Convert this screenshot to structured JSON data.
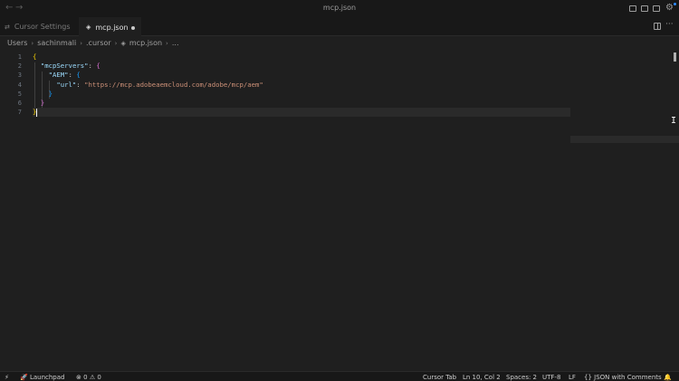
{
  "window": {
    "title": "mcp.json",
    "back_glyph": "←",
    "forward_glyph": "→",
    "settings_glyph": "⚙"
  },
  "tabs": [
    {
      "label": "Cursor Settings",
      "icon": "settings-file-icon",
      "glyph": "⇄",
      "active": false
    },
    {
      "label": "mcp.json",
      "icon": "json-file-icon",
      "glyph": "◈",
      "active": true,
      "modified": true
    }
  ],
  "tabbar_actions": {
    "more_glyph": "···"
  },
  "breadcrumb": [
    {
      "label": "Users"
    },
    {
      "label": "sachinmali"
    },
    {
      "label": ".cursor"
    },
    {
      "label": "mcp.json",
      "glyph": "◈"
    },
    {
      "label": "..."
    }
  ],
  "breadcrumb_sep": "›",
  "editor": {
    "line_numbers": [
      "1",
      "2",
      "3",
      "4",
      "5",
      "6",
      "7"
    ],
    "code": {
      "l1_open": "{",
      "l2_key": "\"mcpServers\"",
      "l2_colon": ": ",
      "l2_open": "{",
      "l3_key": "\"AEM\"",
      "l3_colon": ": ",
      "l3_open": "{",
      "l4_key": "\"url\"",
      "l4_colon": ": ",
      "l4_value": "\"https://mcp.adobeaemcloud.com/adobe/mcp/aem\"",
      "l5_close": "}",
      "l6_close": "}",
      "l7_close": "}"
    },
    "ibeam_glyph": "I"
  },
  "statusbar": {
    "remote_glyph": "⚡",
    "launchpad_glyph": "🚀",
    "launchpad": "Launchpad",
    "errors_glyph": "⊗",
    "errors": "0",
    "warnings_glyph": "⚠",
    "warnings": "0",
    "cursor_tab": "Cursor Tab",
    "position": "Ln 10, Col 2",
    "spaces": "Spaces: 2",
    "encoding": "UTF-8",
    "eol": "LF",
    "language_glyph": "{}",
    "language": "JSON with Comments",
    "bell_glyph": "🔔"
  },
  "colors": {
    "background": "#1f1f1f",
    "chrome": "#181818",
    "bracket_yellow": "#ffd700",
    "bracket_pink": "#da70d6",
    "bracket_blue": "#179fff",
    "key": "#9cdcfe",
    "string": "#ce9178"
  }
}
